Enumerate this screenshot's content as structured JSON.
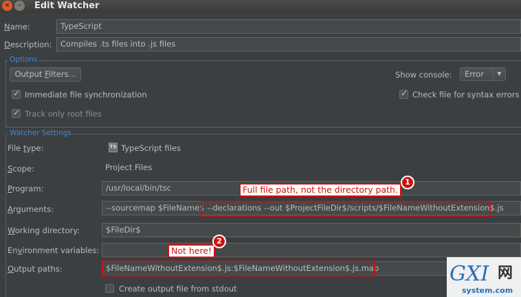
{
  "window": {
    "title": "Edit Watcher",
    "close_glyph": "×",
    "min_glyph": "–"
  },
  "name": {
    "label_u": "N",
    "label_rest": "ame:",
    "value": "TypeScript"
  },
  "description": {
    "label_u": "D",
    "label_rest": "escription:",
    "value": "Compiles .ts files into .js files"
  },
  "options": {
    "title": "Options",
    "output_filters_u": "Output ",
    "output_filters_f": "F",
    "output_filters_rest": "ilters...",
    "show_console_label": "Show console:",
    "show_console_value": "Error",
    "immediate_sync": "Immediate file synchronization",
    "check_syntax": "Check file for syntax errors",
    "track_root": "Track only root files"
  },
  "watcher": {
    "title": "Watcher Settings",
    "file_type": {
      "label_pre": "File ",
      "label_u": "t",
      "label_rest": "ype:",
      "value": "TypeScript files",
      "icon": "TS"
    },
    "scope": {
      "label_u": "S",
      "label_rest": "cope:",
      "value": "Project Files"
    },
    "program": {
      "label_u": "P",
      "label_rest": "rogram:",
      "value": "/usr/local/bin/tsc"
    },
    "arguments": {
      "label_u": "A",
      "label_rest": "rguments:",
      "value_a": "--sourcemap $FileName$",
      "value_b": " --declarations --out $ProjectFileDir$/scripts/$FileNameWithoutExtension$.js"
    },
    "working_dir": {
      "label_u": "W",
      "label_rest": "orking directory:",
      "value": "$FileDir$"
    },
    "env_vars": {
      "label_pre": "En",
      "label_u": "v",
      "label_rest": "ironment variables:",
      "value": ""
    },
    "output_paths": {
      "label_u": "O",
      "label_rest": "utput paths:",
      "value": "$FileNameWithoutExtension$.js:$FileNameWithoutExtension$.js.map"
    },
    "create_stdout": "Create output file from stdout"
  },
  "annotations": {
    "note1": "Full file path, not the directory path.",
    "badge1": "1",
    "note2": "Not here!",
    "badge2": "2"
  },
  "watermark": {
    "logo": "GXI",
    "cjk": "网",
    "url": "system.com"
  }
}
